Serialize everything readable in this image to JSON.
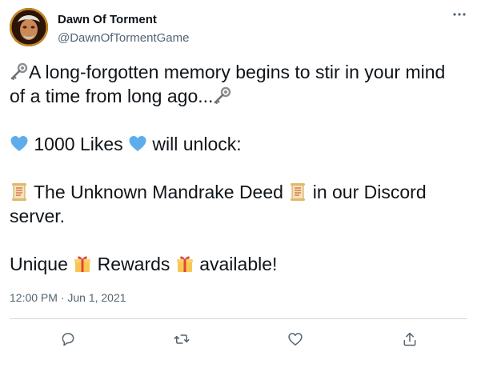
{
  "author": {
    "display_name": "Dawn Of Torment",
    "handle": "@DawnOfTormentGame",
    "avatar_icon": "avatar-image"
  },
  "menu": {
    "icon": "more-icon"
  },
  "tweet": {
    "line1": "A long-forgotten memory begins to stir in your mind",
    "line2": "of a time from long ago...",
    "likes_text": "1000 Likes",
    "unlock_text": "will unlock:",
    "deed_text": "The Unknown Mandrake Deed",
    "discord_text": "in our Discord",
    "server_text": "server.",
    "unique_text": "Unique",
    "rewards_text": "Rewards",
    "available_text": "available!"
  },
  "emoji": {
    "key": "old-key-icon",
    "heart": "blue-heart-icon",
    "scroll": "scroll-icon",
    "gift": "gift-icon"
  },
  "meta": {
    "timestamp": "12:00 PM · Jun 1, 2021"
  },
  "actions": [
    {
      "name": "reply",
      "icon": "reply-icon"
    },
    {
      "name": "retweet",
      "icon": "retweet-icon"
    },
    {
      "name": "like",
      "icon": "like-icon"
    },
    {
      "name": "share",
      "icon": "share-icon"
    }
  ],
  "colors": {
    "text": "#0f1419",
    "muted": "#536471",
    "divider": "#cfd9de",
    "heart": "#5dadec"
  }
}
